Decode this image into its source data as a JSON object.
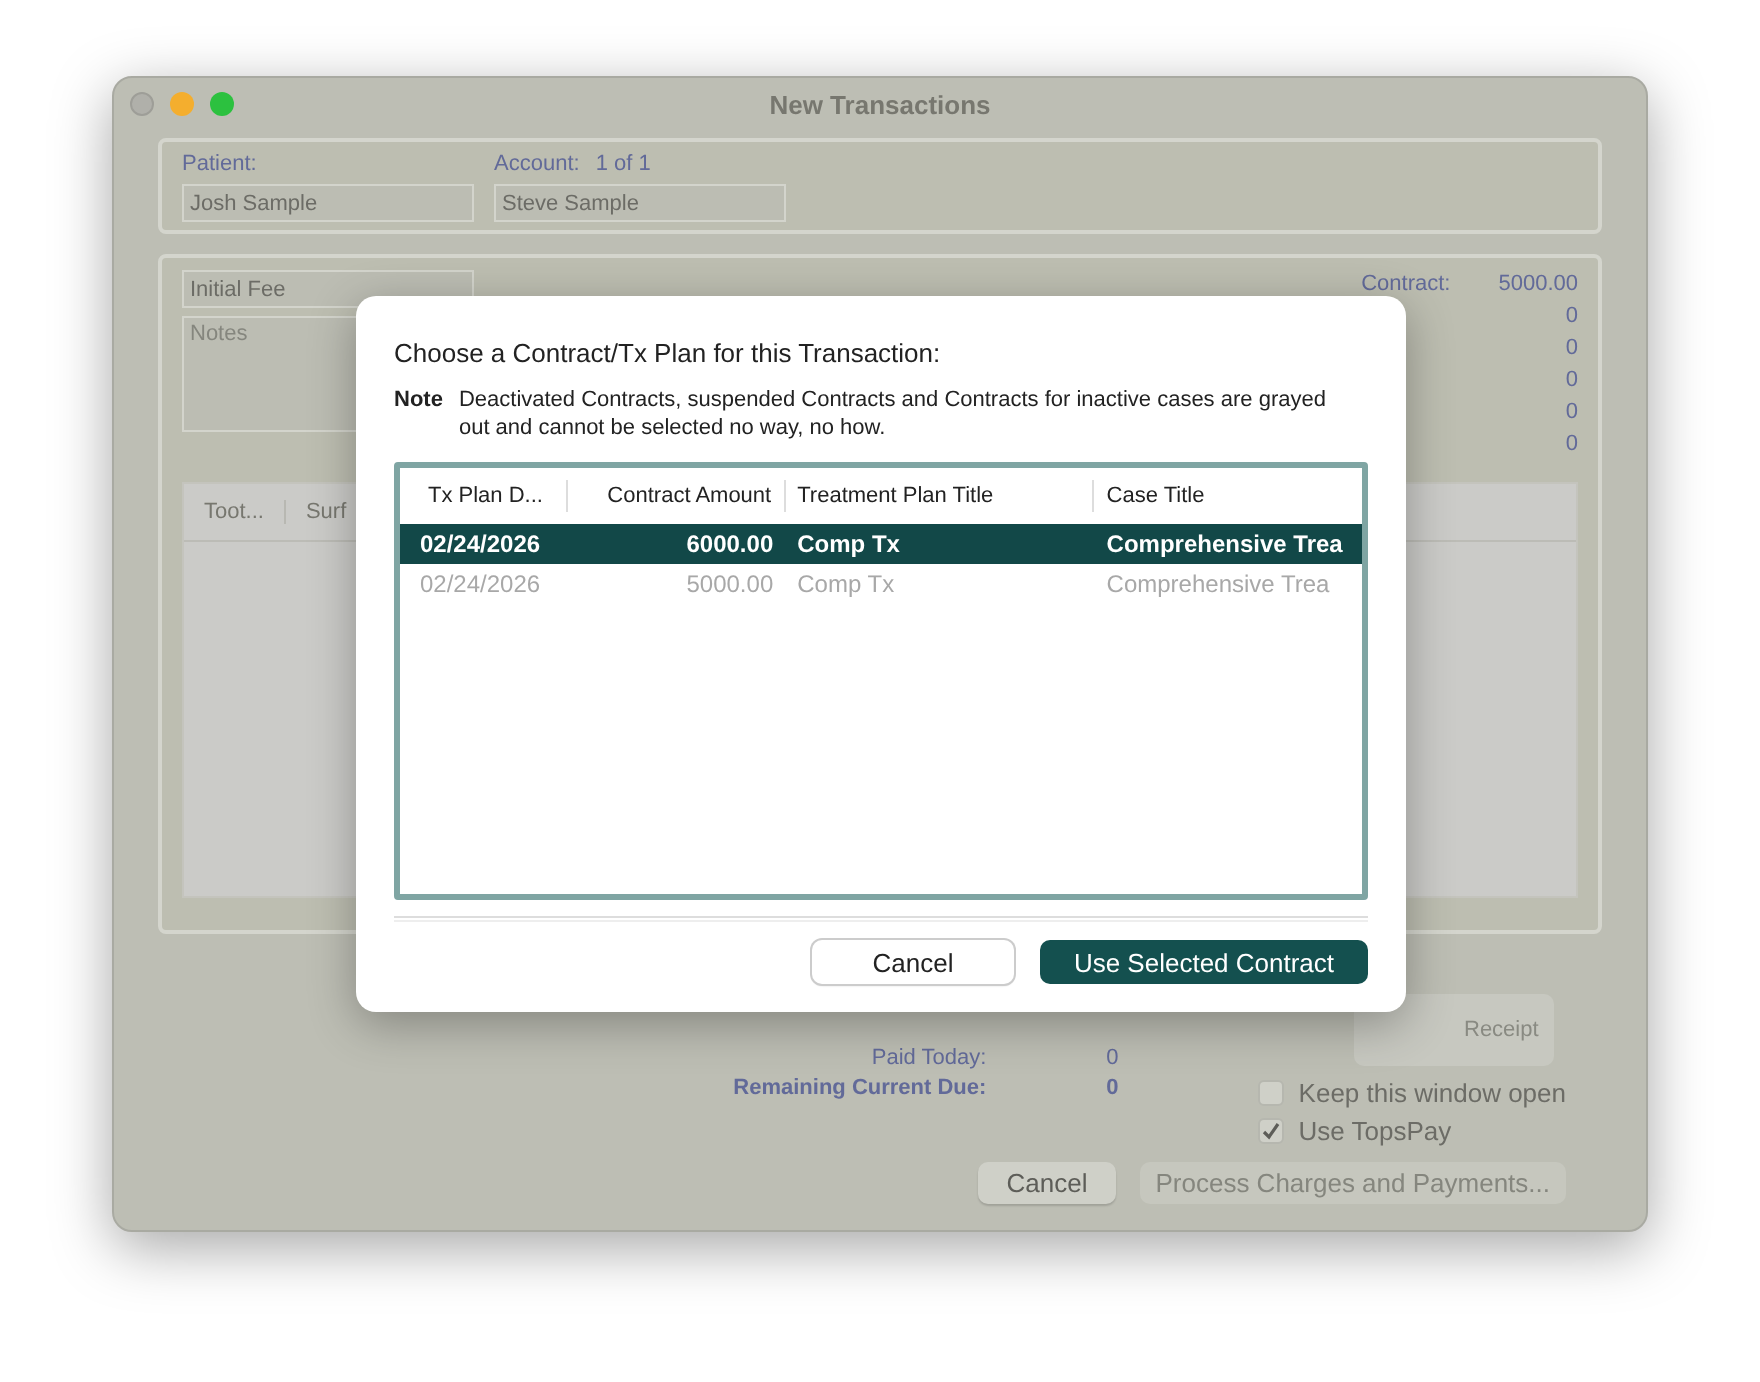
{
  "window": {
    "title": "New Transactions"
  },
  "header": {
    "patient_label": "Patient:",
    "patient": "Josh Sample",
    "account_label": "Account:",
    "account_count": "1 of 1",
    "account": "Steve Sample"
  },
  "entry": {
    "fee_type": "Initial Fee",
    "notes_placeholder": "Notes",
    "contract_label": "Contract:",
    "amounts": [
      "5000.00",
      "0",
      "0",
      "0",
      "0",
      "0"
    ]
  },
  "items_table": {
    "columns": [
      "Toot...",
      "Surf"
    ]
  },
  "totals": [
    {
      "label": "Paid Today:",
      "value": "0",
      "bold": false
    },
    {
      "label": "Remaining Current Due:",
      "value": "0",
      "bold": true
    }
  ],
  "receipt_button": {
    "label": "Receipt",
    "disabled": true
  },
  "options": [
    {
      "label": "Keep this window open",
      "checked": false
    },
    {
      "label": "Use TopsPay",
      "checked": true
    }
  ],
  "buttons": [
    {
      "label": "Cancel",
      "disabled": false
    },
    {
      "label": "Process Charges and Payments...",
      "disabled": true
    }
  ],
  "dialog": {
    "title": "Choose a Contract/Tx Plan for this Transaction:",
    "note_label": "Note",
    "note": "Deactivated Contracts, suspended Contracts and Contracts for inactive cases are grayed out and cannot be selected no way, no how.",
    "columns": [
      "Tx Plan D...",
      "Contract Amount",
      "Treatment Plan Title",
      "Case Title"
    ],
    "rows": [
      {
        "cells": [
          "02/24/2026",
          "6000.00",
          "Comp Tx",
          "Comprehensive Trea"
        ],
        "selected": true,
        "disabled": false
      },
      {
        "cells": [
          "02/24/2026",
          "5000.00",
          "Comp Tx",
          "Comprehensive Trea"
        ],
        "selected": false,
        "disabled": true
      }
    ],
    "buttons": [
      {
        "label": "Cancel",
        "kind": "secondary"
      },
      {
        "label": "Use Selected Contract",
        "kind": "primary"
      }
    ]
  }
}
